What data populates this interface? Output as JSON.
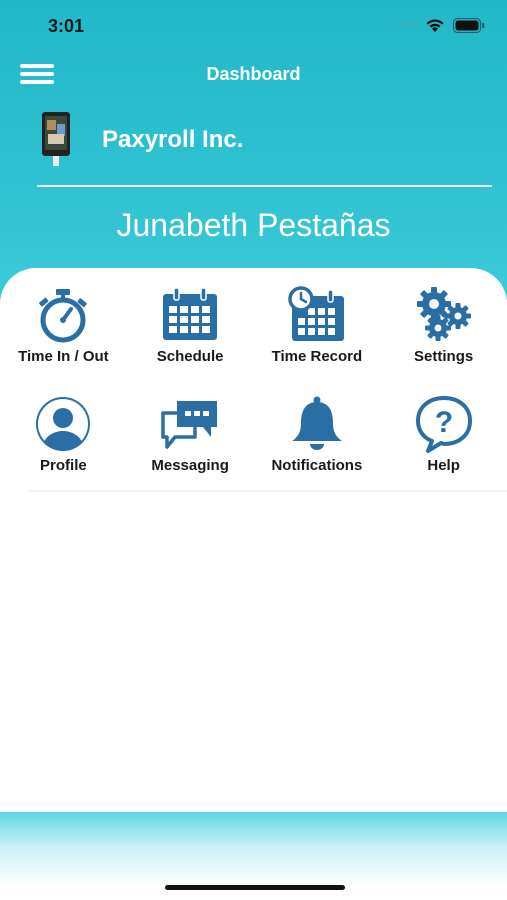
{
  "status_bar": {
    "time": "3:01"
  },
  "header": {
    "title": "Dashboard",
    "company": "Paxyroll Inc.",
    "user_name": "Junabeth Pestañas"
  },
  "menu": {
    "rows": [
      [
        {
          "label": "Time In / Out",
          "icon": "stopwatch-icon"
        },
        {
          "label": "Schedule",
          "icon": "calendar-icon"
        },
        {
          "label": "Time Record",
          "icon": "calendar-history-icon"
        },
        {
          "label": "Settings",
          "icon": "gears-icon"
        }
      ],
      [
        {
          "label": "Profile",
          "icon": "user-icon"
        },
        {
          "label": "Messaging",
          "icon": "chat-icon"
        },
        {
          "label": "Notifications",
          "icon": "bell-icon"
        },
        {
          "label": "Help",
          "icon": "help-icon"
        }
      ]
    ]
  },
  "colors": {
    "header": "#2ec1d1",
    "icon": "#2a6ea6",
    "text": "#1a1a1a"
  }
}
